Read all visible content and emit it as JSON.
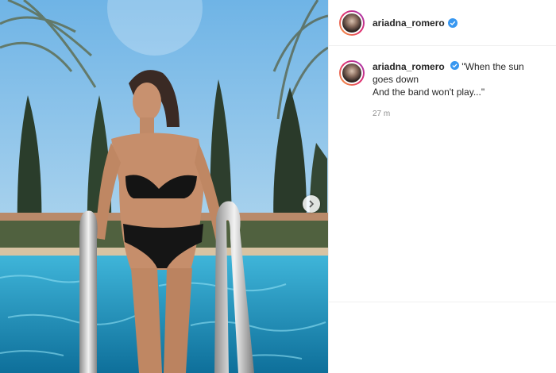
{
  "post": {
    "username": "ariadna_romero",
    "verified": true,
    "caption": "\"When the sun goes down\nAnd the band won't play...\"",
    "time": "27 m",
    "icons": {
      "verified": "verified-badge-icon",
      "next": "chevron-right-icon"
    },
    "colors": {
      "verified": "#3897f0",
      "text": "#262626",
      "muted": "#8e8e8e"
    }
  }
}
